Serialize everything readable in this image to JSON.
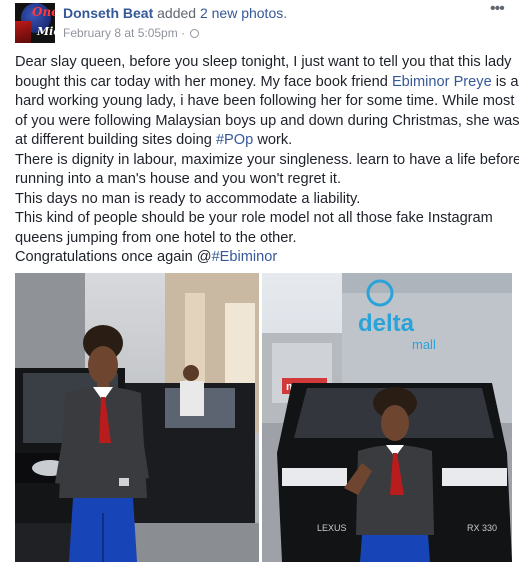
{
  "post": {
    "author": "Donseth Beat",
    "action_prefix": " added ",
    "action_link": "2 new photos",
    "action_suffix": ".",
    "timestamp": "February 8 at 5:05pm",
    "separator": " · ",
    "privacy_icon": "globe-icon",
    "more_icon": "more-options-icon",
    "avatar_text": {
      "top": "One",
      "bottom": "Mic"
    },
    "text": {
      "l1": "Dear slay queen, before you sleep tonight, I just want to tell you that this lady",
      "l2_pre": "bought this car today with her money. My face book friend ",
      "l2_link": "Ebiminor Preye",
      "l2_post": " is a",
      "l3": "hard working young lady, i have been following her for some time. While most",
      "l4": "of you were following Malaysian boys up and down during Christmas, she was",
      "l5_pre": "at different building sites doing ",
      "l5_link": "#POp",
      "l5_post": " work.",
      "l6": "There is dignity in labour, maximize your singleness. learn to have a life before",
      "l7": "running into a man's house and you won't regret it.",
      "l8": "This days no man is ready to accommodate a liability.",
      "l9": "This kind of people should be your role model not all those fake Instagram",
      "l10": "queens jumping from one hotel to the other.",
      "l11_pre": "Congratulations once again @",
      "l11_link": "#Ebiminor"
    },
    "photos": {
      "right_sign_big": "delta",
      "right_sign_small": "mall",
      "right_store_sign": "mrp",
      "right_car_badge": "LEXUS",
      "right_car_model": "RX 330"
    }
  }
}
